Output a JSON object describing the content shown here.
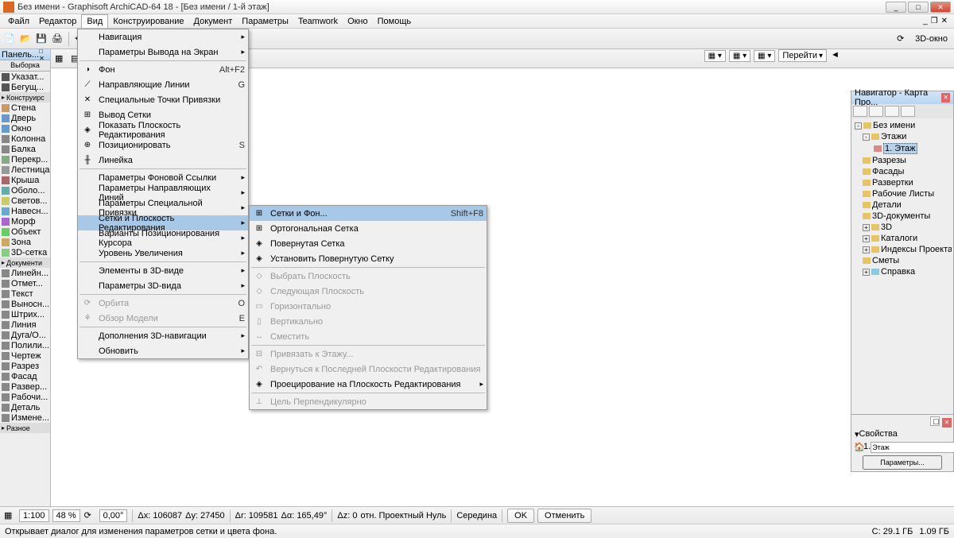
{
  "title": "Без имени - Graphisoft ArchiCAD-64 18 - [Без имени / 1-й этаж]",
  "menubar": {
    "items": [
      "Файл",
      "Редактор",
      "Вид",
      "Конструирование",
      "Документ",
      "Параметры",
      "Teamwork",
      "Окно",
      "Помощь"
    ],
    "active_index": 2
  },
  "toolbox": {
    "header": "Панель...",
    "subheader": "Выборка",
    "pointer": "Указат...",
    "marquee": "Бегущ...",
    "cat_construct": "Конструирс",
    "items_construct": [
      "Стена",
      "Дверь",
      "Окно",
      "Колонна",
      "Балка",
      "Перекр...",
      "Лестница",
      "Крыша",
      "Оболо...",
      "Светов...",
      "Навесн...",
      "Морф",
      "Объект",
      "Зона",
      "3D-сетка"
    ],
    "cat_document": "Документи",
    "items_document": [
      "Линейн...",
      "Отмет...",
      "Текст",
      "Выносн...",
      "Штрих...",
      "Линия",
      "Дуга/О...",
      "Полили...",
      "Чертеж",
      "Разрез",
      "Фасад",
      "Развер...",
      "Рабочи...",
      "Деталь",
      "Измене..."
    ],
    "cat_other": "Разное"
  },
  "view_menu": {
    "items": [
      {
        "label": "Навигация",
        "arrow": true
      },
      {
        "label": "Параметры Вывода на Экран",
        "arrow": true
      },
      {
        "sep": true
      },
      {
        "label": "Фон",
        "shortcut": "Alt+F2",
        "icon": "◑"
      },
      {
        "label": "Направляющие Линии",
        "shortcut": "G",
        "icon": "⟋"
      },
      {
        "label": "Специальные Точки Привязки",
        "icon": "✕"
      },
      {
        "label": "Вывод Сетки",
        "icon": "⊞"
      },
      {
        "label": "Показать Плоскость Редактирования",
        "icon": "◈"
      },
      {
        "label": "Позиционировать",
        "shortcut": "S",
        "icon": "⊕"
      },
      {
        "label": "Линейка",
        "icon": "╫"
      },
      {
        "sep": true
      },
      {
        "label": "Параметры Фоновой Ссылки",
        "arrow": true
      },
      {
        "label": "Параметры Направляющих Линий",
        "arrow": true
      },
      {
        "label": "Параметры Специальной Привязки",
        "arrow": true
      },
      {
        "label": "Сетки и Плоскость Редактирования",
        "arrow": true,
        "highlighted": true
      },
      {
        "label": "Варианты Позиционирования Курсора",
        "arrow": true
      },
      {
        "label": "Уровень Увеличения",
        "arrow": true
      },
      {
        "sep": true
      },
      {
        "label": "Элементы в 3D-виде",
        "arrow": true
      },
      {
        "label": "Параметры 3D-вида",
        "arrow": true
      },
      {
        "sep": true
      },
      {
        "label": "Орбита",
        "shortcut": "O",
        "disabled": true,
        "icon": "⟳"
      },
      {
        "label": "Обзор Модели",
        "shortcut": "E",
        "disabled": true,
        "icon": "⚘"
      },
      {
        "sep": true
      },
      {
        "label": "Дополнения 3D-навигации",
        "arrow": true
      },
      {
        "label": "Обновить",
        "arrow": true
      }
    ]
  },
  "submenu": {
    "items": [
      {
        "label": "Сетки и Фон...",
        "shortcut": "Shift+F8",
        "highlighted": true,
        "icon": "⊞"
      },
      {
        "label": "Ортогональная Сетка",
        "icon": "⊞"
      },
      {
        "label": "Повернутая Сетка",
        "icon": "◈"
      },
      {
        "label": "Установить Повернутую Сетку",
        "icon": "◈"
      },
      {
        "sep": true
      },
      {
        "label": "Выбрать Плоскость",
        "disabled": true,
        "icon": "◇"
      },
      {
        "label": "Следующая Плоскость",
        "disabled": true,
        "icon": "◇"
      },
      {
        "label": "Горизонтально",
        "disabled": true,
        "icon": "▭"
      },
      {
        "label": "Вертикально",
        "disabled": true,
        "icon": "▯"
      },
      {
        "label": "Сместить",
        "disabled": true,
        "icon": "↔"
      },
      {
        "sep": true
      },
      {
        "label": "Привязать к Этажу...",
        "disabled": true,
        "icon": "⊟"
      },
      {
        "label": "Вернуться к Последней Плоскости Редактирования",
        "disabled": true,
        "icon": "↶"
      },
      {
        "label": "Проецирование на Плоскость Редактирования",
        "arrow": true,
        "icon": "◈"
      },
      {
        "sep": true
      },
      {
        "label": "Цель Перпендикулярно",
        "disabled": true,
        "icon": "⊥"
      }
    ]
  },
  "navigator": {
    "title": "Навигатор - Карта Про...",
    "root": "Без имени",
    "floors": "Этажи",
    "floor1": "1. Этаж",
    "sections": "Разрезы",
    "facades": "Фасады",
    "unfolds": "Развертки",
    "worksheets": "Рабочие Листы",
    "details": "Детали",
    "docs3d": "3D-документы",
    "view3d": "3D",
    "catalogs": "Каталоги",
    "indexes": "Индексы Проекта",
    "estimates": "Сметы",
    "help": "Справка",
    "props_title": "Свойства",
    "prop_num": "1.",
    "prop_name": "Этаж",
    "params_btn": "Параметры..."
  },
  "bottombar": {
    "zoom": "1:100",
    "pct": "48 %",
    "angle": "0,00°",
    "dx": "Δx: 106087",
    "dy": "Δy: 27450",
    "ar": "Δr: 109581",
    "aa": "Δα: 165,49°",
    "az": "Δz: 0",
    "ref": "отн. Проектный Нуль",
    "mid": "Середина",
    "ok": "OK",
    "cancel": "Отменить"
  },
  "statusbar": {
    "msg": "Открывает диалог для изменения параметров сетки и цвета фона.",
    "disk_c": "C: 29.1 ГБ",
    "mem": "1.09 ГБ"
  },
  "top_right": {
    "goto": "Перейти",
    "view3d": "3D-окно"
  }
}
